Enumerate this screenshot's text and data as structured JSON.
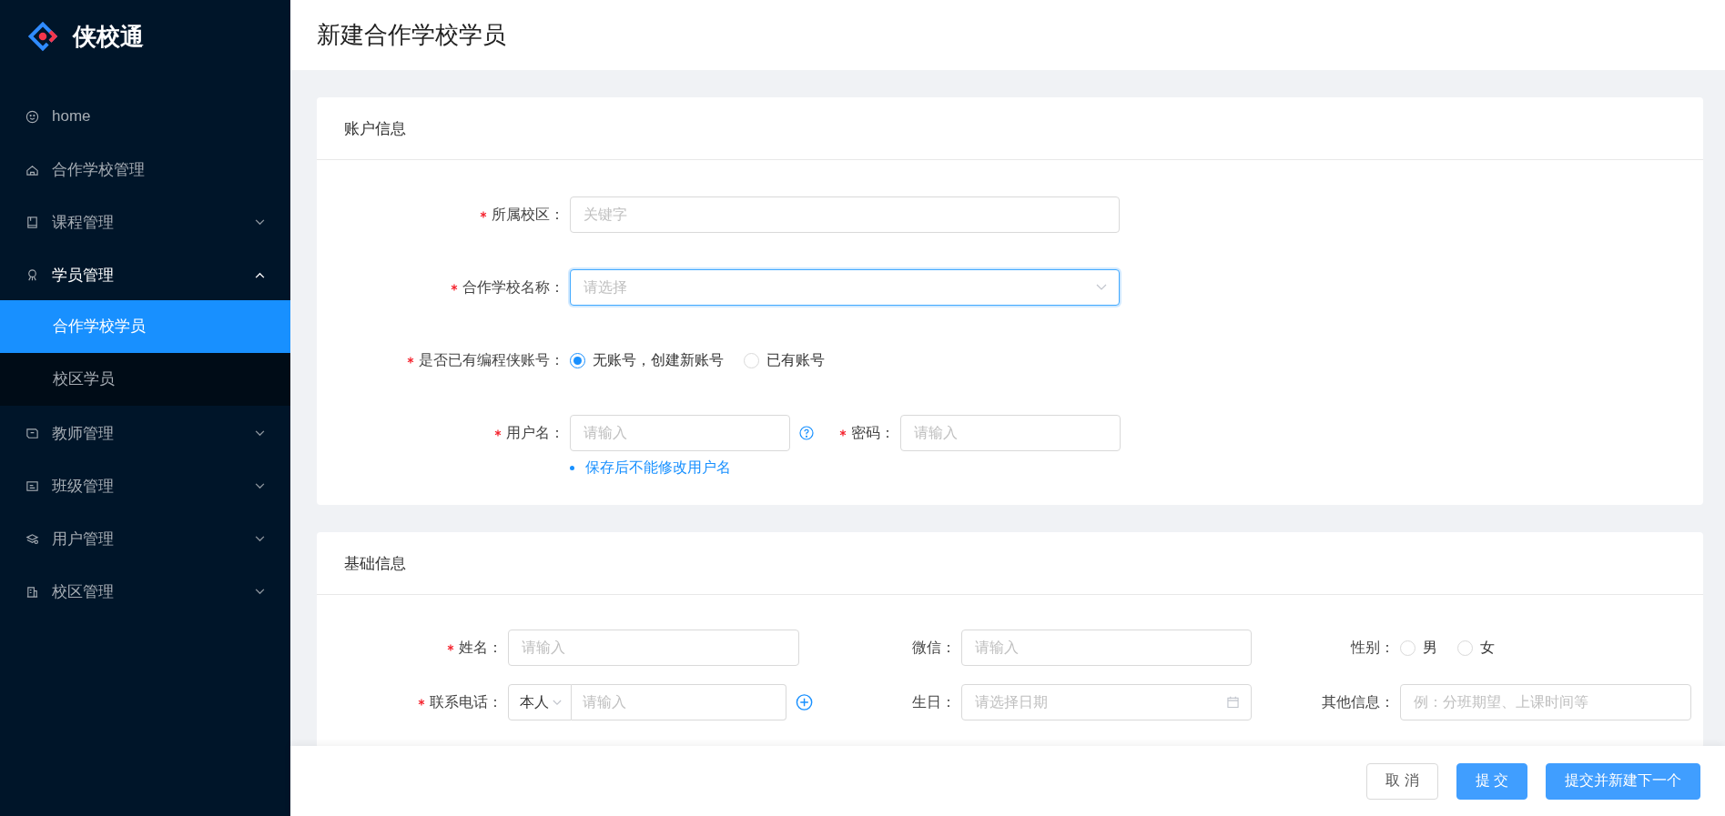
{
  "sidebar": {
    "logo": "侠校通",
    "items": [
      {
        "label": "home"
      },
      {
        "label": "合作学校管理"
      },
      {
        "label": "课程管理",
        "expanded": false
      },
      {
        "label": "学员管理",
        "expanded": true,
        "children": [
          {
            "label": "合作学校学员",
            "selected": true
          },
          {
            "label": "校区学员",
            "selected": false
          }
        ]
      },
      {
        "label": "教师管理",
        "expanded": false
      },
      {
        "label": "班级管理",
        "expanded": false
      },
      {
        "label": "用户管理",
        "expanded": false
      },
      {
        "label": "校区管理",
        "expanded": false
      }
    ]
  },
  "page_title": "新建合作学校学员",
  "account_info": {
    "title": "账户信息",
    "rows": [
      {
        "kind": "input",
        "label": "所属校区：",
        "required": true,
        "placeholder": "关键字"
      },
      {
        "kind": "select",
        "label": "合作学校名称：",
        "required": true,
        "placeholder": "请选择",
        "focused": true
      },
      {
        "kind": "radio",
        "label": "是否已有编程侠账号：",
        "required": true,
        "options": [
          {
            "label": "无账号，创建新账号",
            "selected": true
          },
          {
            "label": "已有账号",
            "selected": false
          }
        ]
      },
      {
        "kind": "pair",
        "fields": [
          {
            "label": "用户名：",
            "required": true,
            "placeholder": "请输入",
            "help": true
          },
          {
            "label": "密码：",
            "required": true,
            "placeholder": "请输入"
          }
        ],
        "hint": "保存后不能修改用户名"
      }
    ]
  },
  "basic_info": {
    "title": "基础信息",
    "fields": [
      {
        "kind": "input",
        "label": "姓名：",
        "required": true,
        "placeholder": "请输入"
      },
      {
        "kind": "input",
        "label": "微信：",
        "required": false,
        "placeholder": "请输入"
      },
      {
        "kind": "radio",
        "label": "性别：",
        "required": false,
        "options": [
          {
            "label": "男",
            "selected": false
          },
          {
            "label": "女",
            "selected": false
          }
        ]
      },
      {
        "kind": "phone",
        "label": "联系电话：",
        "required": true,
        "prefix": "本人",
        "placeholder": "请输入"
      },
      {
        "kind": "date",
        "label": "生日：",
        "required": false,
        "placeholder": "请选择日期"
      },
      {
        "kind": "input",
        "label": "其他信息：",
        "required": false,
        "placeholder": "例：分班期望、上课时间等"
      }
    ]
  },
  "footer": {
    "buttons": [
      {
        "label": "取 消",
        "kind": "default"
      },
      {
        "label": "提 交",
        "kind": "primary"
      },
      {
        "label": "提交并新建下一个",
        "kind": "primary"
      }
    ]
  }
}
